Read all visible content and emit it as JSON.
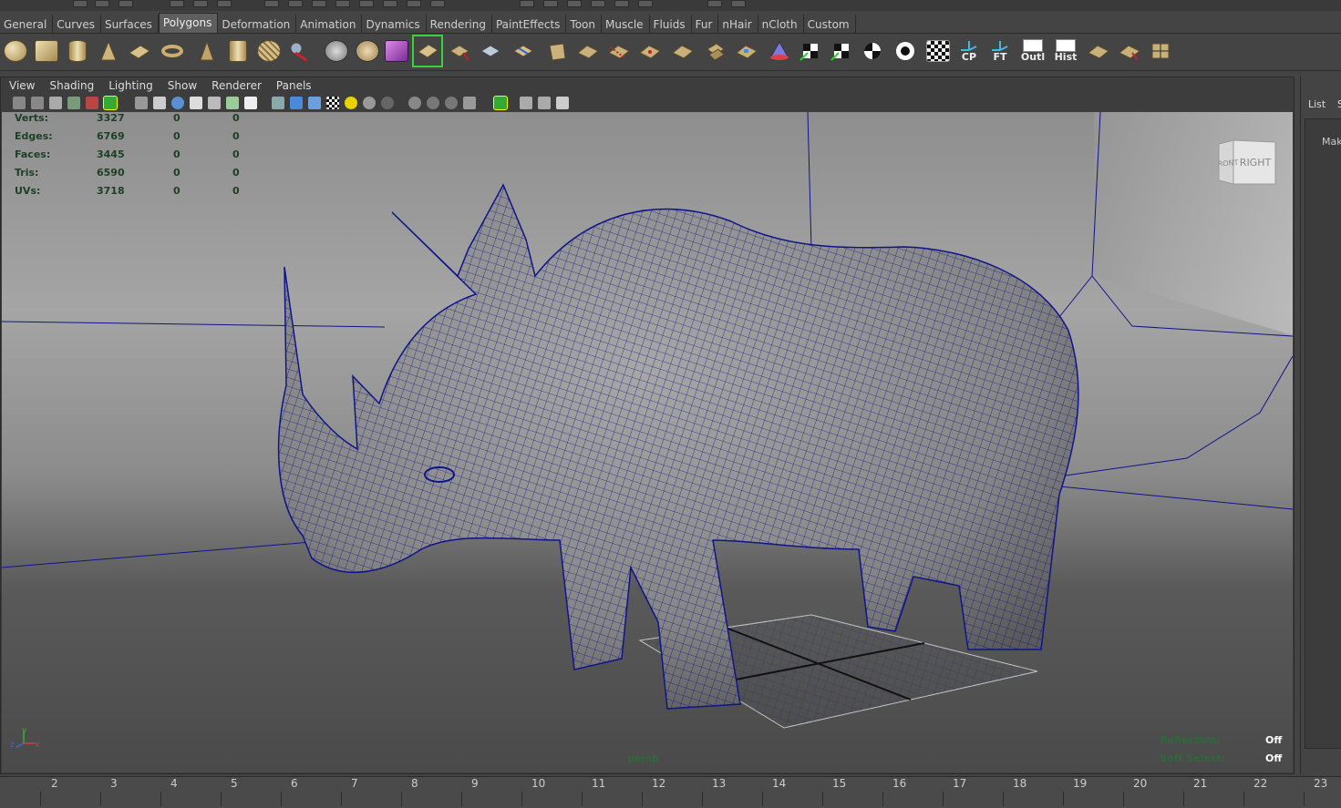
{
  "shelf_tabs": [
    "General",
    "Curves",
    "Surfaces",
    "Polygons",
    "Deformation",
    "Animation",
    "Dynamics",
    "Rendering",
    "PaintEffects",
    "Toon",
    "Muscle",
    "Fluids",
    "Fur",
    "nHair",
    "nCloth",
    "Custom"
  ],
  "active_tab": "Polygons",
  "shelf_labels": {
    "cp": "CP",
    "ft": "FT",
    "outl": "Outl",
    "hist": "Hist"
  },
  "panel_menu": [
    "View",
    "Shading",
    "Lighting",
    "Show",
    "Renderer",
    "Panels"
  ],
  "hud": {
    "rows": [
      {
        "label": "Verts:",
        "v1": "3327",
        "v2": "0",
        "v3": "0"
      },
      {
        "label": "Edges:",
        "v1": "6769",
        "v2": "0",
        "v3": "0"
      },
      {
        "label": "Faces:",
        "v1": "3445",
        "v2": "0",
        "v3": "0"
      },
      {
        "label": "Tris:",
        "v1": "6590",
        "v2": "0",
        "v3": "0"
      },
      {
        "label": "UVs:",
        "v1": "3718",
        "v2": "0",
        "v3": "0"
      }
    ]
  },
  "viewcube": {
    "front": "FRONT",
    "right": "RIGHT"
  },
  "camera_label": "persp",
  "axis": {
    "x": "x",
    "y": "y",
    "z": "z"
  },
  "status": {
    "reflection_label": "Reflection:",
    "reflection_value": "Off",
    "soft_select_label": "Soft Select:",
    "soft_select_value": "Off"
  },
  "timeline_ticks": [
    "2",
    "3",
    "4",
    "5",
    "6",
    "7",
    "8",
    "9",
    "10",
    "11",
    "12",
    "13",
    "14",
    "15",
    "16",
    "17",
    "18",
    "19",
    "20",
    "21",
    "22",
    "23"
  ],
  "right_panel": {
    "tab_list": "List",
    "tab_s": "S",
    "make": "Mak"
  },
  "colors": {
    "wire": "#10148a",
    "hud_text": "#1c3f25",
    "active_tab": "#5e5e5e"
  }
}
